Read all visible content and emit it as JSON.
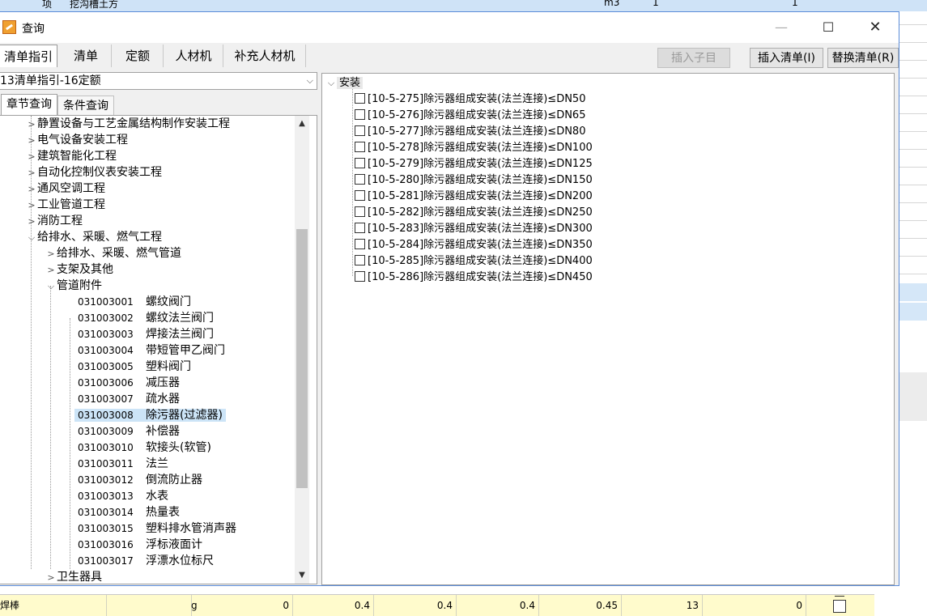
{
  "background": {
    "top_row": {
      "c1": "项",
      "c2": "挖沟槽土方",
      "unit": "m3",
      "v1": "1",
      "v2": "1"
    },
    "bottom_row": {
      "name": "焊棒",
      "unit": "g",
      "c1": "0",
      "c2": "0.4",
      "c3": "0.4",
      "c4": "0.4",
      "c5": "0.45",
      "c6": "13",
      "c7": "0"
    }
  },
  "dialog": {
    "title": "查询",
    "window_buttons": {
      "minimize": "—",
      "maximize": "☐",
      "close": "✕"
    },
    "tabs": [
      "清单指引",
      "清单",
      "定额",
      "人材机",
      "补充人材机"
    ],
    "toolbar": {
      "insert_child": "插入子目",
      "insert_list": "插入清单(I)",
      "replace_list": "替换清单(R)"
    },
    "combo": {
      "value": "13清单指引-16定额",
      "arrow": "⌵"
    },
    "subtabs": [
      "章节查询",
      "条件查询"
    ],
    "tree": {
      "top_items": [
        "静置设备与工艺金属结构制作安装工程",
        "电气设备安装工程",
        "建筑智能化工程",
        "自动化控制仪表安装工程",
        "通风空调工程",
        "工业管道工程",
        "消防工程"
      ],
      "expanded_item": "给排水、采暖、燃气工程",
      "sub_items": [
        "给排水、采暖、燃气管道",
        "支架及其他"
      ],
      "expanded_sub": "管道附件",
      "leaves": [
        {
          "code": "031003001",
          "name": "螺纹阀门"
        },
        {
          "code": "031003002",
          "name": "螺纹法兰阀门"
        },
        {
          "code": "031003003",
          "name": "焊接法兰阀门"
        },
        {
          "code": "031003004",
          "name": "带短管甲乙阀门"
        },
        {
          "code": "031003005",
          "name": "塑料阀门"
        },
        {
          "code": "031003006",
          "name": "减压器"
        },
        {
          "code": "031003007",
          "name": "疏水器"
        },
        {
          "code": "031003008",
          "name": "除污器(过滤器)"
        },
        {
          "code": "031003009",
          "name": "补偿器"
        },
        {
          "code": "031003010",
          "name": "软接头(软管)"
        },
        {
          "code": "031003011",
          "name": "法兰"
        },
        {
          "code": "031003012",
          "name": "倒流防止器"
        },
        {
          "code": "031003013",
          "name": "水表"
        },
        {
          "code": "031003014",
          "name": "热量表"
        },
        {
          "code": "031003015",
          "name": "塑料排水管消声器"
        },
        {
          "code": "031003016",
          "name": "浮标液面计"
        },
        {
          "code": "031003017",
          "name": "浮漂水位标尺"
        }
      ],
      "selected_code": "031003008",
      "partial_item": "卫生器具"
    },
    "right_tree": {
      "root": "安装",
      "items": [
        "[10-5-275]除污器组成安装(法兰连接)≤DN50",
        "[10-5-276]除污器组成安装(法兰连接)≤DN65",
        "[10-5-277]除污器组成安装(法兰连接)≤DN80",
        "[10-5-278]除污器组成安装(法兰连接)≤DN100",
        "[10-5-279]除污器组成安装(法兰连接)≤DN125",
        "[10-5-280]除污器组成安装(法兰连接)≤DN150",
        "[10-5-281]除污器组成安装(法兰连接)≤DN200",
        "[10-5-282]除污器组成安装(法兰连接)≤DN250",
        "[10-5-283]除污器组成安装(法兰连接)≤DN300",
        "[10-5-284]除污器组成安装(法兰连接)≤DN350",
        "[10-5-285]除污器组成安装(法兰连接)≤DN400",
        "[10-5-286]除污器组成安装(法兰连接)≤DN450"
      ]
    }
  }
}
